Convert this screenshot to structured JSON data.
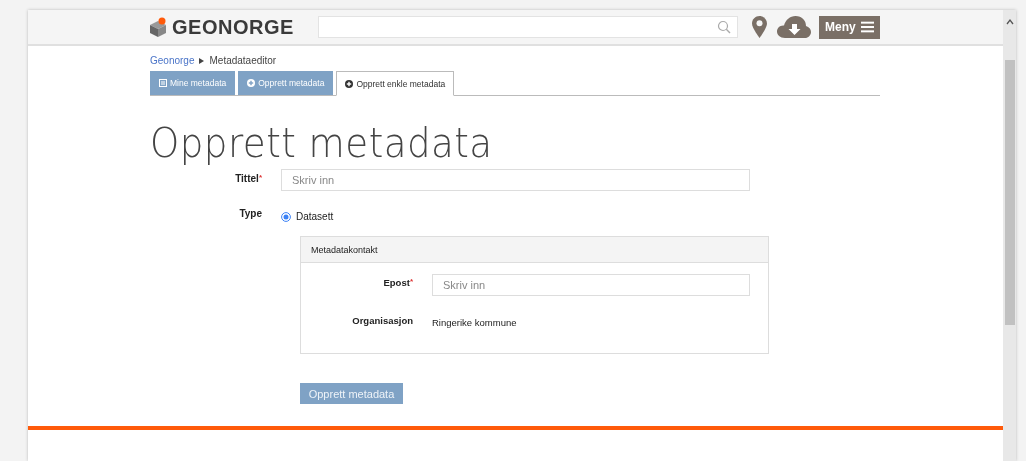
{
  "header": {
    "logo_text": "GEONORGE",
    "menu_button": "Meny"
  },
  "breadcrumb": [
    {
      "label": "Geonorge",
      "kind": "link"
    },
    {
      "label": "Metadataeditor",
      "kind": "current"
    }
  ],
  "tabs": [
    {
      "label": "Mine metadata",
      "kind": "list",
      "selected": false
    },
    {
      "label": "Opprett metadata",
      "kind": "add",
      "selected": false
    },
    {
      "label": "Opprett enkle metadata",
      "kind": "add",
      "selected": true
    }
  ],
  "heading": "Opprett metadata",
  "form": {
    "title_field": {
      "label": "Tittel",
      "required_mark": "*",
      "placeholder": "Skriv inn"
    },
    "type": {
      "label": "Type",
      "options": [
        {
          "label": "Datasett",
          "selected": true
        }
      ]
    },
    "contact_panel": {
      "title": "Metadatakontakt",
      "email": {
        "label": "Epost",
        "required_mark": "*",
        "placeholder": "Skriv inn"
      },
      "organization": {
        "label": "Organisasjon",
        "value": "Ringerike kommune"
      }
    },
    "submit": "Opprett metadata"
  }
}
